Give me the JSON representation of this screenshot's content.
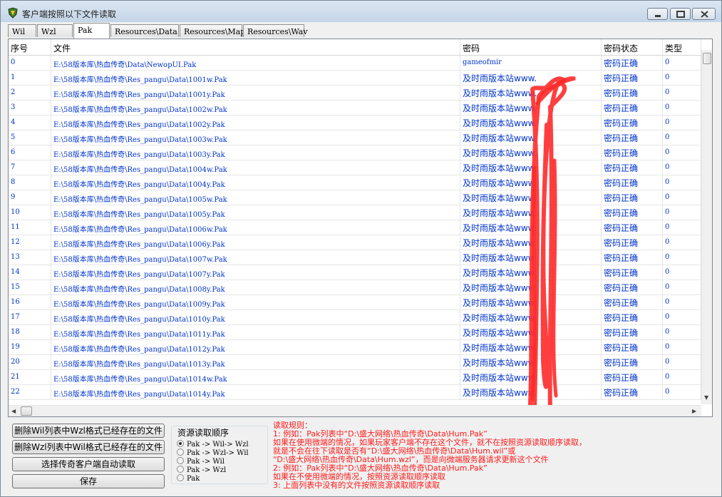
{
  "window": {
    "title": "客户端按照以下文件读取",
    "controls": {
      "minimize": "minimize",
      "maximize": "maximize",
      "close": "close"
    }
  },
  "tabs": [
    {
      "label": "Wil",
      "active": false
    },
    {
      "label": "Wzl",
      "active": false
    },
    {
      "label": "Pak",
      "active": true
    },
    {
      "label": "Resources\\Data",
      "active": false
    },
    {
      "label": "Resources\\Map",
      "active": false
    },
    {
      "label": "Resources\\Wav",
      "active": false
    }
  ],
  "table": {
    "columns": [
      "序号",
      "文件",
      "密码",
      "密码状态",
      "类型"
    ],
    "rows": [
      {
        "index": "0",
        "file": "E:\\58版本库\\热血传奇\\Data\\NewopUI.Pak",
        "password": "gameofmir",
        "status": "密码正确",
        "type": "0"
      },
      {
        "index": "1",
        "file": "E:\\58版本库\\热血传奇\\Res_pangu\\Data\\1001w.Pak",
        "password": "及时雨版本站www.",
        "status": "密码正确",
        "type": "0"
      },
      {
        "index": "2",
        "file": "E:\\58版本库\\热血传奇\\Res_pangu\\Data\\1001y.Pak",
        "password": "及时雨版本站www.",
        "status": "密码正确",
        "type": "0"
      },
      {
        "index": "3",
        "file": "E:\\58版本库\\热血传奇\\Res_pangu\\Data\\1002w.Pak",
        "password": "及时雨版本站www.",
        "status": "密码正确",
        "type": "0"
      },
      {
        "index": "4",
        "file": "E:\\58版本库\\热血传奇\\Res_pangu\\Data\\1002y.Pak",
        "password": "及时雨版本站www.",
        "status": "密码正确",
        "type": "0"
      },
      {
        "index": "5",
        "file": "E:\\58版本库\\热血传奇\\Res_pangu\\Data\\1003w.Pak",
        "password": "及时雨版本站www.",
        "status": "密码正确",
        "type": "0"
      },
      {
        "index": "6",
        "file": "E:\\58版本库\\热血传奇\\Res_pangu\\Data\\1003y.Pak",
        "password": "及时雨版本站www.",
        "status": "密码正确",
        "type": "0"
      },
      {
        "index": "7",
        "file": "E:\\58版本库\\热血传奇\\Res_pangu\\Data\\1004w.Pak",
        "password": "及时雨版本站www.",
        "status": "密码正确",
        "type": "0"
      },
      {
        "index": "8",
        "file": "E:\\58版本库\\热血传奇\\Res_pangu\\Data\\1004y.Pak",
        "password": "及时雨版本站www.",
        "status": "密码正确",
        "type": "0"
      },
      {
        "index": "9",
        "file": "E:\\58版本库\\热血传奇\\Res_pangu\\Data\\1005w.Pak",
        "password": "及时雨版本站www.",
        "status": "密码正确",
        "type": "0"
      },
      {
        "index": "10",
        "file": "E:\\58版本库\\热血传奇\\Res_pangu\\Data\\1005y.Pak",
        "password": "及时雨版本站www.",
        "status": "密码正确",
        "type": "0"
      },
      {
        "index": "11",
        "file": "E:\\58版本库\\热血传奇\\Res_pangu\\Data\\1006w.Pak",
        "password": "及时雨版本站www.",
        "status": "密码正确",
        "type": "0"
      },
      {
        "index": "12",
        "file": "E:\\58版本库\\热血传奇\\Res_pangu\\Data\\1006y.Pak",
        "password": "及时雨版本站www.",
        "status": "密码正确",
        "type": "0"
      },
      {
        "index": "13",
        "file": "E:\\58版本库\\热血传奇\\Res_pangu\\Data\\1007w.Pak",
        "password": "及时雨版本站www.",
        "status": "密码正确",
        "type": "0"
      },
      {
        "index": "14",
        "file": "E:\\58版本库\\热血传奇\\Res_pangu\\Data\\1007y.Pak",
        "password": "及时雨版本站www.",
        "status": "密码正确",
        "type": "0"
      },
      {
        "index": "15",
        "file": "E:\\58版本库\\热血传奇\\Res_pangu\\Data\\1008y.Pak",
        "password": "及时雨版本站www.",
        "status": "密码正确",
        "type": "0"
      },
      {
        "index": "16",
        "file": "E:\\58版本库\\热血传奇\\Res_pangu\\Data\\1009y.Pak",
        "password": "及时雨版本站www.",
        "status": "密码正确",
        "type": "0"
      },
      {
        "index": "17",
        "file": "E:\\58版本库\\热血传奇\\Res_pangu\\Data\\1010y.Pak",
        "password": "及时雨版本站www.",
        "status": "密码正确",
        "type": "0"
      },
      {
        "index": "18",
        "file": "E:\\58版本库\\热血传奇\\Res_pangu\\Data\\1011y.Pak",
        "password": "及时雨版本站www.",
        "status": "密码正确",
        "type": "0"
      },
      {
        "index": "19",
        "file": "E:\\58版本库\\热血传奇\\Res_pangu\\Data\\1012y.Pak",
        "password": "及时雨版本站www.",
        "status": "密码正确",
        "type": "0"
      },
      {
        "index": "20",
        "file": "E:\\58版本库\\热血传奇\\Res_pangu\\Data\\1013y.Pak",
        "password": "及时雨版本站www.",
        "status": "密码正确",
        "type": "0"
      },
      {
        "index": "21",
        "file": "E:\\58版本库\\热血传奇\\Res_pangu\\Data\\1014w.Pak",
        "password": "及时雨版本站www.",
        "status": "密码正确",
        "type": "0"
      },
      {
        "index": "22",
        "file": "E:\\58版本库\\热血传奇\\Res_pangu\\Data\\1014y.Pak",
        "password": "及时雨版本站www.",
        "status": "密码正确",
        "type": "0"
      }
    ]
  },
  "buttons": {
    "delete_wil": "删除Wil列表中Wzl格式已经存在的文件",
    "delete_wzl": "删除Wzl列表中Wil格式已经存在的文件",
    "select_client": "选择传奇客户端自动读取",
    "save": "保存"
  },
  "read_order": {
    "title": "资源读取顺序",
    "options": [
      {
        "label": "Pak -> Wil-> Wzl",
        "selected": true
      },
      {
        "label": "Pak -> Wzl-> Wil",
        "selected": false
      },
      {
        "label": "Pak -> Wil",
        "selected": false
      },
      {
        "label": "Pak -> Wzl",
        "selected": false
      },
      {
        "label": "Pak",
        "selected": false
      }
    ]
  },
  "rules": {
    "lines": [
      "读取规则：",
      "1: 例如：Pak列表中“D:\\盛大网络\\热血传奇\\Data\\Hum.Pak”",
      "    如果在使用微端的情况，如果玩家客户端不存在这个文件，就不在按照资源读取顺序读取，",
      "    就是不会在往下读取是否有“D:\\盛大网络\\热血传奇\\Data\\Hum.wil”或",
      "    “D:\\盛大网络\\热血传奇\\Data\\Hum.wzl”，而是向微端服务器请求更新这个文件",
      "2: 例如：Pak列表中“D:\\盛大网络\\热血传奇\\Data\\Hum.Pak”",
      "    如果在不使用微端的情况，按照资源读取顺序读取",
      "3: 上面列表中没有的文件按照资源读取顺序读取"
    ]
  },
  "colors": {
    "link_text": "#0033cc",
    "rules_text": "#ff1a1a",
    "scribble": "#ff2a2a"
  }
}
